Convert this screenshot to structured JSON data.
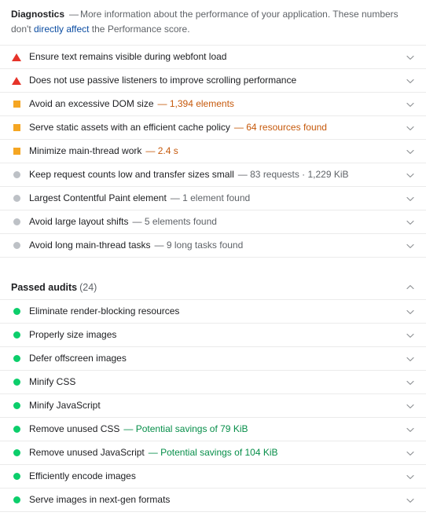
{
  "diagnostics": {
    "title": "Diagnostics",
    "dash": "—",
    "desc_part1": "More information about the performance of your application. These numbers don't ",
    "link_text": "directly affect",
    "desc_part2": " the Performance score.",
    "colors": {
      "fail": "#e63329",
      "average": "#f5a623",
      "info": "#bdc1c6",
      "pass": "#0cce6b",
      "link": "#0b4da2",
      "average_text": "#c6590b",
      "pass_text": "#068e49",
      "info_text": "#5f6368"
    },
    "audits": [
      {
        "icon": "warning-triangle-icon",
        "severity": "fail",
        "title": "Ensure text remains visible during webfont load",
        "value": "",
        "chevron": "chevron-down-icon"
      },
      {
        "icon": "warning-triangle-icon",
        "severity": "fail",
        "title": "Does not use passive listeners to improve scrolling performance",
        "value": "",
        "chevron": "chevron-down-icon"
      },
      {
        "icon": "square-icon",
        "severity": "average",
        "title": "Avoid an excessive DOM size",
        "value": "— 1,394 elements",
        "chevron": "chevron-down-icon"
      },
      {
        "icon": "square-icon",
        "severity": "average",
        "title": "Serve static assets with an efficient cache policy",
        "value": "— 64 resources found",
        "chevron": "chevron-down-icon"
      },
      {
        "icon": "square-icon",
        "severity": "average",
        "title": "Minimize main-thread work",
        "value": "— 2.4 s",
        "chevron": "chevron-down-icon"
      },
      {
        "icon": "circle-icon",
        "severity": "info",
        "title": "Keep request counts low and transfer sizes small",
        "value": "— 83 requests · 1,229 KiB",
        "chevron": "chevron-down-icon"
      },
      {
        "icon": "circle-icon",
        "severity": "info",
        "title": "Largest Contentful Paint element",
        "value": "— 1 element found",
        "chevron": "chevron-down-icon"
      },
      {
        "icon": "circle-icon",
        "severity": "info",
        "title": "Avoid large layout shifts",
        "value": "— 5 elements found",
        "chevron": "chevron-down-icon"
      },
      {
        "icon": "circle-icon",
        "severity": "info",
        "title": "Avoid long main-thread tasks",
        "value": "— 9 long tasks found",
        "chevron": "chevron-down-icon"
      }
    ]
  },
  "passed_audits": {
    "title": "Passed audits",
    "count": "(24)",
    "expanded": true,
    "chevron": "chevron-up-icon",
    "audits": [
      {
        "icon": "circle-icon",
        "severity": "pass",
        "title": "Eliminate render-blocking resources",
        "value": "",
        "chevron": "chevron-down-icon"
      },
      {
        "icon": "circle-icon",
        "severity": "pass",
        "title": "Properly size images",
        "value": "",
        "chevron": "chevron-down-icon"
      },
      {
        "icon": "circle-icon",
        "severity": "pass",
        "title": "Defer offscreen images",
        "value": "",
        "chevron": "chevron-down-icon"
      },
      {
        "icon": "circle-icon",
        "severity": "pass",
        "title": "Minify CSS",
        "value": "",
        "chevron": "chevron-down-icon"
      },
      {
        "icon": "circle-icon",
        "severity": "pass",
        "title": "Minify JavaScript",
        "value": "",
        "chevron": "chevron-down-icon"
      },
      {
        "icon": "circle-icon",
        "severity": "pass",
        "title": "Remove unused CSS",
        "value": "— Potential savings of 79 KiB",
        "chevron": "chevron-down-icon"
      },
      {
        "icon": "circle-icon",
        "severity": "pass",
        "title": "Remove unused JavaScript",
        "value": "— Potential savings of 104 KiB",
        "chevron": "chevron-down-icon"
      },
      {
        "icon": "circle-icon",
        "severity": "pass",
        "title": "Efficiently encode images",
        "value": "",
        "chevron": "chevron-down-icon"
      },
      {
        "icon": "circle-icon",
        "severity": "pass",
        "title": "Serve images in next-gen formats",
        "value": "",
        "chevron": "chevron-down-icon"
      }
    ]
  }
}
